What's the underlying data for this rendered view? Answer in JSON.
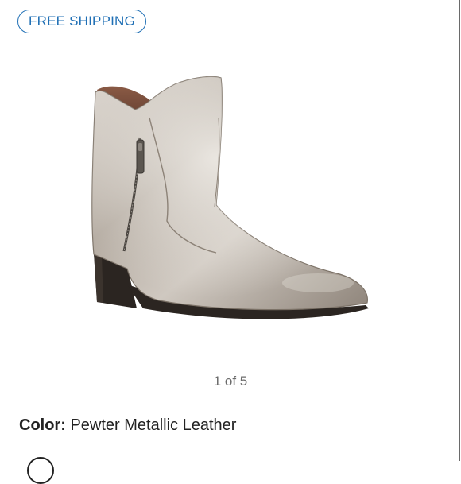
{
  "badge": {
    "label": "FREE SHIPPING"
  },
  "gallery": {
    "counter": "1 of 5",
    "image_subject": "ankle-boot-icon"
  },
  "details": {
    "color_label": "Color:",
    "color_value": "Pewter Metallic Leather"
  },
  "colors": {
    "accent": "#1f6fb5",
    "counter_text": "#6b6b6b",
    "boot_metallic": "#b9b0a5",
    "sole": "#2b2521"
  }
}
